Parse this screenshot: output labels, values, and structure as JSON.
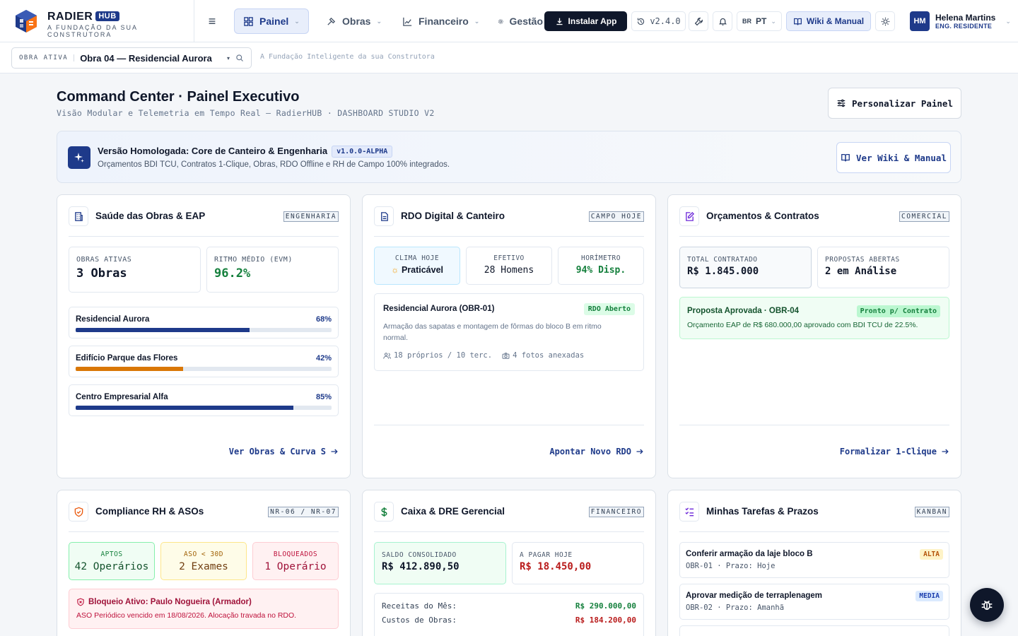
{
  "brand": {
    "name": "RADIER",
    "badge": "HUB",
    "tagline": "A FUNDAÇÃO DA SUA CONSTRUTORA"
  },
  "nav": [
    {
      "label": "Painel",
      "icon": "grid-icon",
      "active": true
    },
    {
      "label": "Obras",
      "icon": "hammer-icon"
    },
    {
      "label": "Financeiro",
      "icon": "chart-line-icon"
    },
    {
      "label": "Gestão",
      "icon": "gear-icon"
    }
  ],
  "toolbar": {
    "install_label": "Instalar App",
    "version_label": "v2.4.0",
    "lang_flag": "BR",
    "lang_label": "PT",
    "wiki_label": "Wiki & Manual"
  },
  "user": {
    "initials": "HM",
    "name": "Helena Martins",
    "role": "ENG. RESIDENTE"
  },
  "obra_selector": {
    "label": "OBRA ATIVA",
    "value": "Obra 04 — Residencial Aurora"
  },
  "subbar_tagline": "A Fundação Inteligente da sua Construtora",
  "page": {
    "title": "Command Center · Painel Executivo",
    "subtitle": "Visão Modular e Telemetria em Tempo Real — RadierHUB · DASHBOARD STUDIO V2",
    "customize_label": "Personalizar Painel"
  },
  "banner": {
    "title": "Versão Homologada: Core de Canteiro & Engenharia",
    "version": "v1.0.0-ALPHA",
    "description": "Orçamentos BDI TCU, Contratos 1-Clique, Obras, RDO Offline e RH de Campo 100% integrados.",
    "button_label": "Ver Wiki & Manual"
  },
  "cards": {
    "saude": {
      "title": "Saúde das Obras & EAP",
      "tag": "ENGENHARIA",
      "stats": [
        {
          "label": "OBRAS ATIVAS",
          "value": "3 Obras",
          "color": "#0f172a"
        },
        {
          "label": "RITMO MÉDIO (EVM)",
          "value": "96.2%",
          "color": "#15803d"
        }
      ],
      "projects": [
        {
          "name": "Residencial Aurora",
          "pct_label": "68%",
          "progress": 0.68,
          "color": "#1e3a8a"
        },
        {
          "name": "Edifício Parque das Flores",
          "pct_label": "42%",
          "progress": 0.42,
          "color": "#d97706"
        },
        {
          "name": "Centro Empresarial Alfa",
          "pct_label": "85%",
          "progress": 0.85,
          "color": "#1e3a8a"
        }
      ],
      "link": "Ver Obras & Curva S"
    },
    "rdo": {
      "title": "RDO Digital & Canteiro",
      "tag": "CAMPO HOJE",
      "stats": [
        {
          "label": "CLIMA HOJE",
          "value": "Praticável"
        },
        {
          "label": "EFETIVO",
          "value": "28 Homens"
        },
        {
          "label": "HORÍMETRO",
          "value": "94% Disp."
        }
      ],
      "entry": {
        "name": "Residencial Aurora (OBR-01)",
        "badge": "RDO Aberto",
        "description": "Armação das sapatas e montagem de fôrmas do bloco B em ritmo normal.",
        "staff": "18 próprios / 10 terc.",
        "photos": "4 fotos anexadas"
      },
      "link": "Apontar Novo RDO"
    },
    "orcamentos": {
      "title": "Orçamentos & Contratos",
      "tag": "COMERCIAL",
      "stats": [
        {
          "label": "TOTAL CONTRATADO",
          "value": "R$ 1.845.000"
        },
        {
          "label": "PROPOSTAS ABERTAS",
          "value": "2 em Análise"
        }
      ],
      "approved": {
        "title": "Proposta Aprovada · OBR-04",
        "badge": "Pronto p/ Contrato",
        "description": "Orçamento EAP de R$ 680.000,00 aprovado com BDI TCU de 22.5%."
      },
      "link": "Formalizar 1-Clique"
    },
    "rh": {
      "title": "Compliance RH & ASOs",
      "tag": "NR-06 / NR-07",
      "stats": [
        {
          "label": "APTOS",
          "value": "42 Operários"
        },
        {
          "label": "ASO < 30D",
          "value": "2 Exames"
        },
        {
          "label": "BLOQUEADOS",
          "value": "1 Operário"
        }
      ],
      "alert": {
        "title": "Bloqueio Ativo: Paulo Nogueira (Armador)",
        "description": "ASO Periódico vencido em 18/08/2026. Alocação travada no RDO."
      }
    },
    "caixa": {
      "title": "Caixa & DRE Gerencial",
      "tag": "FINANCEIRO",
      "stats": [
        {
          "label": "SALDO CONSOLIDADO",
          "value": "R$ 412.890,50"
        },
        {
          "label": "A PAGAR HOJE",
          "value": "R$ 18.450,00"
        }
      ],
      "rows": [
        {
          "label": "Receitas do Mês:",
          "value": "R$ 290.000,00"
        },
        {
          "label": "Custos de Obras:",
          "value": "R$ 184.200,00"
        }
      ]
    },
    "tarefas": {
      "title": "Minhas Tarefas & Prazos",
      "tag": "KANBAN",
      "tasks": [
        {
          "title": "Conferir armação da laje bloco B",
          "meta": "OBR-01 · Prazo: Hoje",
          "badge": "ALTA"
        },
        {
          "title": "Aprovar medição de terraplenagem",
          "meta": "OBR-02 · Prazo: Amanhã",
          "badge": "MEDIA"
        }
      ]
    }
  }
}
